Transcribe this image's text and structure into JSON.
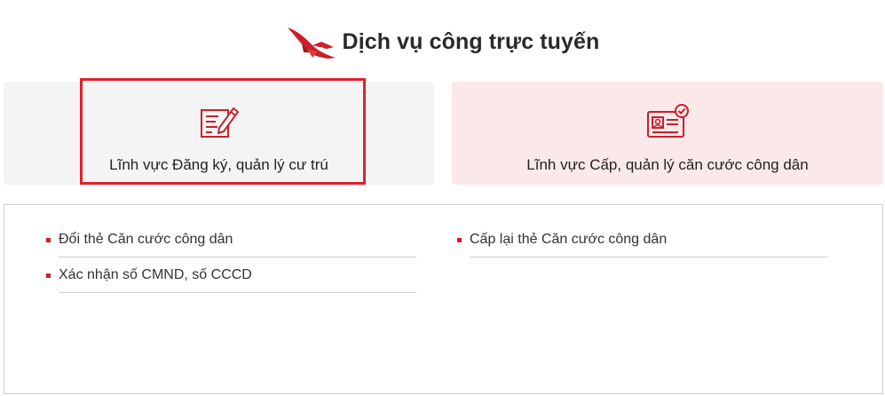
{
  "header": {
    "title": "Dịch vụ công trực tuyến",
    "logo_icon": "police-emblem-bird-icon"
  },
  "cards": [
    {
      "label": "Lĩnh vực Đăng ký, quản lý cư trú",
      "icon": "form-pen-icon",
      "selected": true
    },
    {
      "label": "Lĩnh vực Cấp, quản lý căn cước công dân",
      "icon": "id-card-check-icon",
      "selected": false
    }
  ],
  "services": {
    "left": [
      {
        "label": "Đổi thẻ Căn cước công dân"
      },
      {
        "label": "Xác nhận số CMND, số CCCD"
      }
    ],
    "right": [
      {
        "label": "Cấp lại thẻ Căn cước công dân"
      }
    ]
  },
  "colors": {
    "accent": "#d0202a",
    "highlight_border": "#e0202a",
    "card_left_bg": "#f4f4f4",
    "card_right_bg": "#fbe9e9"
  }
}
